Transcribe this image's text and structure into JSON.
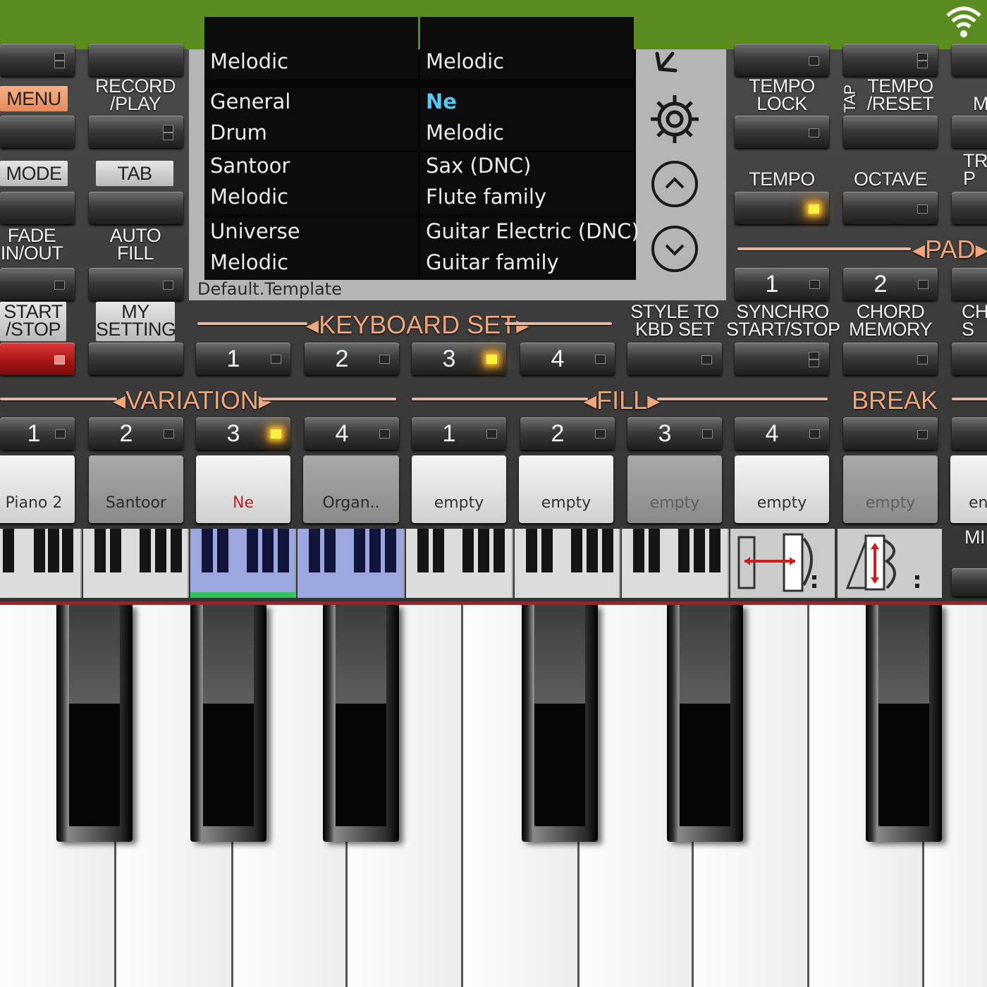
{
  "status_bar": {
    "icon": "wifi-icon"
  },
  "left_panel": {
    "menu": "MENU",
    "record_play": "RECORD\n/PLAY",
    "mode": "MODE",
    "tab": "TAB",
    "fade_in_out": "FADE\nIN/OUT",
    "auto_fill": "AUTO\nFILL",
    "start_stop": "START\n/STOP",
    "my_setting": "MY\nSETTING"
  },
  "voice_list": {
    "rows": [
      {
        "left": [
          "",
          "Melodic"
        ],
        "right": [
          "",
          "Melodic"
        ]
      },
      {
        "left": [
          "General",
          "Drum"
        ],
        "right": [
          "Ne",
          "Melodic"
        ]
      },
      {
        "left": [
          "Santoor",
          "Melodic"
        ],
        "right": [
          "Sax (DNC)",
          "Flute family"
        ]
      },
      {
        "left": [
          "Universe",
          "Melodic"
        ],
        "right": [
          "Guitar Electric (DNC)",
          "Guitar family"
        ]
      }
    ],
    "template": "Default.Template",
    "icons": [
      "back-arrow-icon",
      "gear-icon",
      "chevron-up-icon",
      "chevron-down-icon"
    ]
  },
  "right_panel": {
    "tempo_lock": "TEMPO\nLOCK",
    "tap": "TAP",
    "tempo_reset": "TEMPO\n/RESET",
    "tempo": "TEMPO",
    "octave": "OCTAVE",
    "pad": "PAD",
    "pad_buttons": [
      "1",
      "2"
    ],
    "style_to_kbd_set": "STYLE TO\nKBD SET",
    "synchro_start_stop": "SYNCHRO\nSTART/STOP",
    "chord_memory": "CHORD\nMEMORY",
    "partial": {
      "m": "M",
      "tr": "TR\nP",
      "ch": "CH\nS",
      "mi": "MI"
    }
  },
  "keyboard_set": {
    "title": "KEYBOARD SET",
    "buttons": [
      "1",
      "2",
      "3",
      "4"
    ],
    "active": "3"
  },
  "variation": {
    "title": "VARIATION",
    "buttons": [
      "1",
      "2",
      "3",
      "4"
    ],
    "active": "3"
  },
  "fill": {
    "title": "FILL",
    "buttons": [
      "1",
      "2",
      "3",
      "4"
    ]
  },
  "break": {
    "title": "BREAK"
  },
  "presets": [
    "Piano 2",
    "Santoor",
    "Ne",
    "Organ..",
    "empty",
    "empty",
    "empty",
    "empty",
    "empty",
    "en"
  ],
  "colors": {
    "status_bar": "#5b8c1f",
    "accent_label": "#f0a57a",
    "led_on": "#fff23a",
    "highlight_text": "#58c8f5",
    "start_stop": "#c81e1e"
  }
}
